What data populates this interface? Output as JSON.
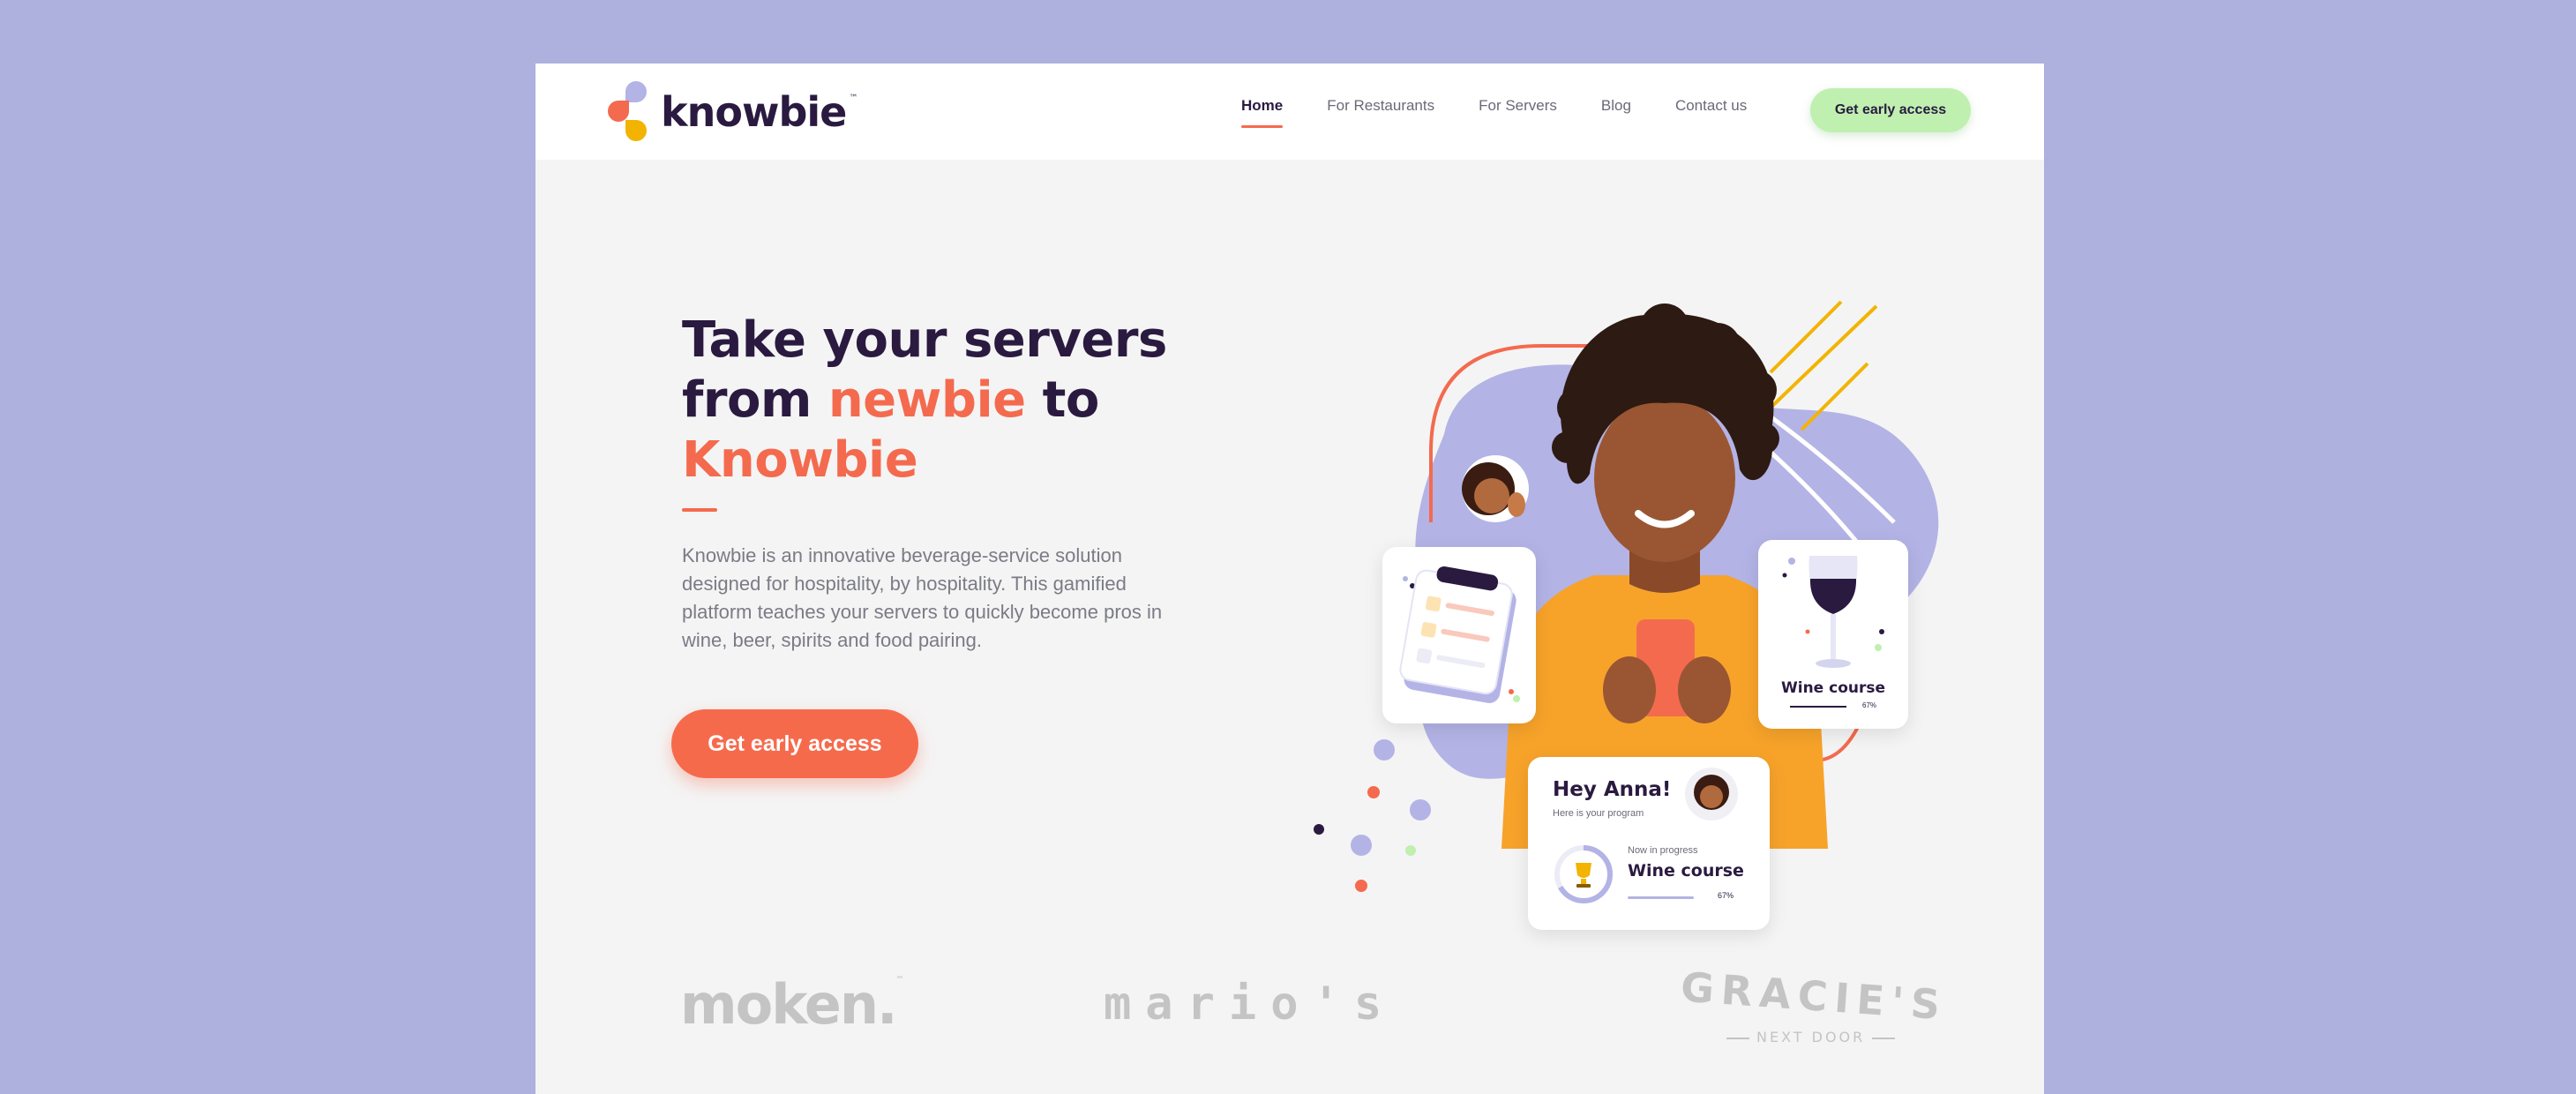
{
  "brand": {
    "name": "knowbie",
    "trademark": "™"
  },
  "nav": {
    "items": [
      {
        "label": "Home",
        "active": true
      },
      {
        "label": "For Restaurants",
        "active": false
      },
      {
        "label": "For Servers",
        "active": false
      },
      {
        "label": "Blog",
        "active": false
      },
      {
        "label": "Contact us",
        "active": false
      }
    ],
    "cta_label": "Get early access"
  },
  "hero": {
    "title_line1": "Take your servers",
    "title_line2_a": "from ",
    "title_line2_accent": "newbie",
    "title_line2_b": " to",
    "title_line3_accent": "Knowbie",
    "description": "Knowbie is an innovative beverage-service solution designed for hospitality, by hospitality. This gamified platform teaches your servers to quickly become pros in wine, beer, spirits and food pairing.",
    "cta_label": "Get early access"
  },
  "program_card": {
    "greeting": "Hey Anna!",
    "subtitle": "Here is your program",
    "status_label": "Now in progress",
    "course_title": "Wine course",
    "progress_text": "67%",
    "progress": 0.67
  },
  "wine_card": {
    "title": "Wine course",
    "progress_text": "67%",
    "progress": 0.67
  },
  "partners": {
    "moken": "moken.",
    "moken_tm": "™",
    "marios": "mario's",
    "gracies": "GRACIE'S",
    "gracies_sub": "NEXT DOOR"
  },
  "colors": {
    "background": "#aeb0de",
    "accent": "#f46a4e",
    "dark": "#2a1a40",
    "lavender": "#b3b3e6",
    "green": "#bff0b0",
    "sweater": "#f7a32a"
  }
}
